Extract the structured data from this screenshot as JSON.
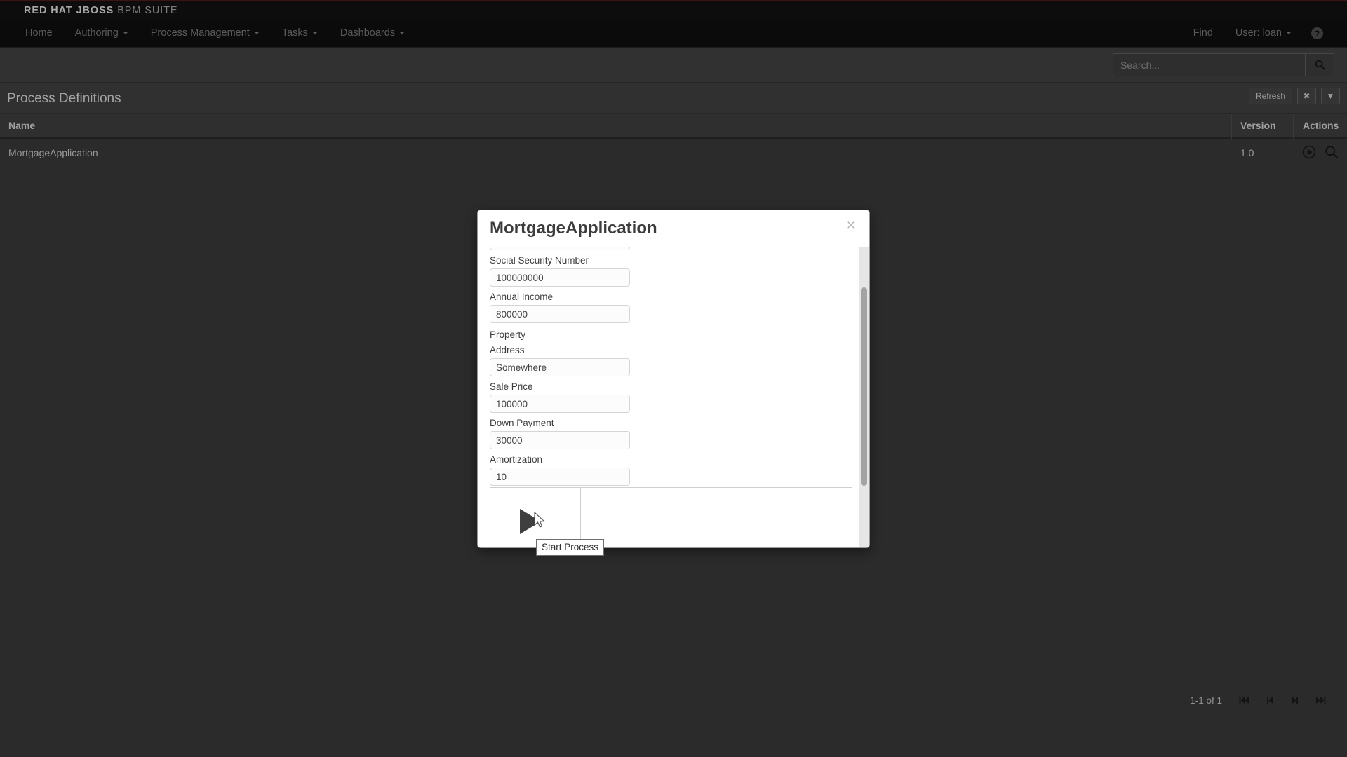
{
  "brand": {
    "bold_text": "RED HAT JBOSS",
    "light_text": "BPM SUITE"
  },
  "nav": {
    "items": [
      {
        "label": "Home",
        "has_caret": false
      },
      {
        "label": "Authoring",
        "has_caret": true
      },
      {
        "label": "Process Management",
        "has_caret": true
      },
      {
        "label": "Tasks",
        "has_caret": true
      },
      {
        "label": "Dashboards",
        "has_caret": true
      }
    ],
    "find_label": "Find",
    "user_label": "User: loan",
    "help_label": "?"
  },
  "search": {
    "value": "",
    "placeholder": "Search...",
    "icon": "search-icon"
  },
  "panel": {
    "title": "Process Definitions",
    "refresh_label": "Refresh",
    "close_label": "✖",
    "menu_label": "▼"
  },
  "table": {
    "columns": [
      "Name",
      "Version",
      "Actions"
    ],
    "rows": [
      {
        "name": "MortgageApplication",
        "version": "1.0",
        "actions": [
          "play-circle-icon",
          "search-icon"
        ]
      }
    ]
  },
  "pagination": {
    "range_label": "1-1 of 1",
    "buttons": [
      "first-page-icon",
      "previous-page-icon",
      "next-page-icon",
      "last-page-icon"
    ]
  },
  "modal": {
    "title": "MortgageApplication",
    "close_label": "×",
    "fields": [
      {
        "label": "Social Security Number",
        "value": "100000000",
        "focused": false
      },
      {
        "label": "Annual Income",
        "value": "800000",
        "focused": false
      }
    ],
    "section": {
      "label": "Property",
      "fields": [
        {
          "label": "Address",
          "value": "Somewhere",
          "focused": false
        },
        {
          "label": "Sale Price",
          "value": "100000",
          "focused": false
        },
        {
          "label": "Down Payment",
          "value": "30000",
          "focused": false
        },
        {
          "label": "Amortization",
          "value": "10",
          "focused": true
        }
      ]
    },
    "start_button": "start-process-button"
  },
  "tooltip": {
    "text": "Start Process"
  },
  "colors": {
    "page_background": "#2b2b2b",
    "brand_bar": "#0d0d0d",
    "brand_accent": "#3d1412",
    "panel_header": "#303030",
    "modal_background": "#ffffff",
    "text_muted": "#8e8e8e",
    "play_button": "#3f3f3f"
  }
}
